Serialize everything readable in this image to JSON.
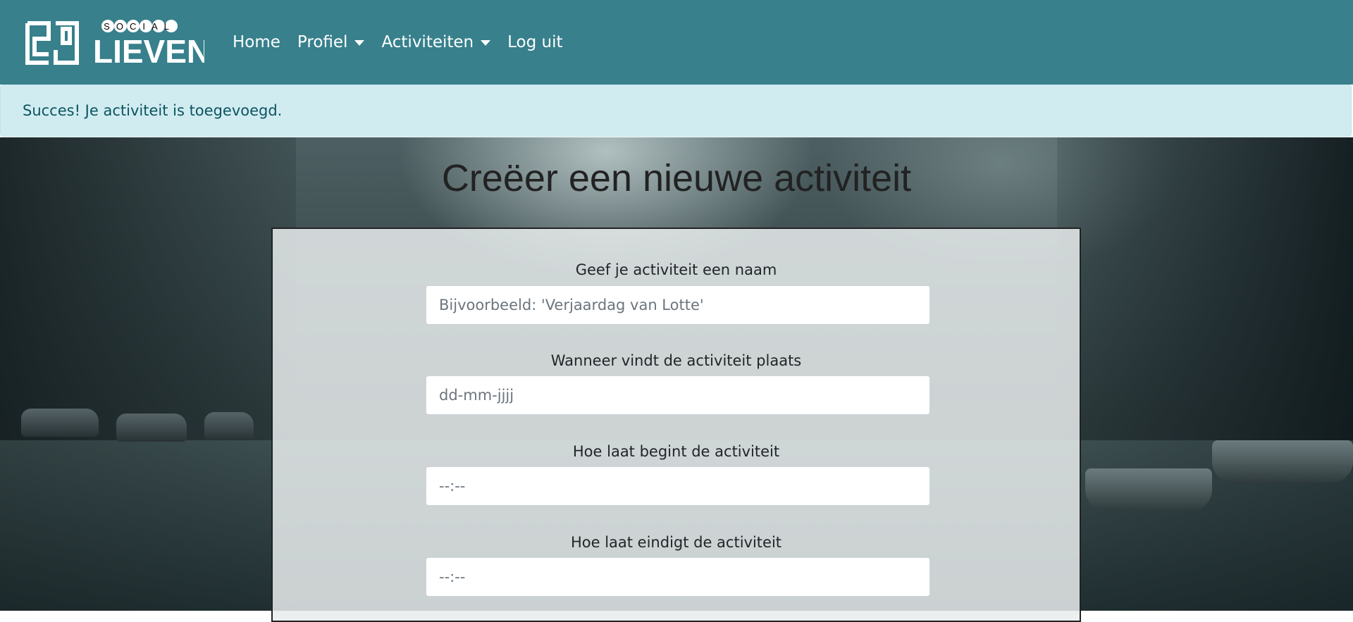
{
  "brand": {
    "logo_top": "SOCIAL",
    "logo_bottom": "LIEVEN"
  },
  "nav": {
    "home": "Home",
    "profiel": "Profiel",
    "activiteiten": "Activiteiten",
    "logout": "Log uit"
  },
  "alert": {
    "message": "Succes! Je activiteit is toegevoegd."
  },
  "page": {
    "title": "Creëer een nieuwe activiteit"
  },
  "form": {
    "name_label": "Geef je activiteit een naam",
    "name_placeholder": "Bijvoorbeeld: 'Verjaardag van Lotte'",
    "date_label": "Wanneer vindt de activiteit plaats",
    "date_placeholder": "dd-mm-jjjj",
    "start_label": "Hoe laat begint de activiteit",
    "start_placeholder": "--:--",
    "end_label": "Hoe laat eindigt de activiteit",
    "end_placeholder": "--:--"
  },
  "colors": {
    "navbar": "#37808c",
    "alert_bg": "#d1ecf1",
    "alert_text": "#0c5460"
  }
}
